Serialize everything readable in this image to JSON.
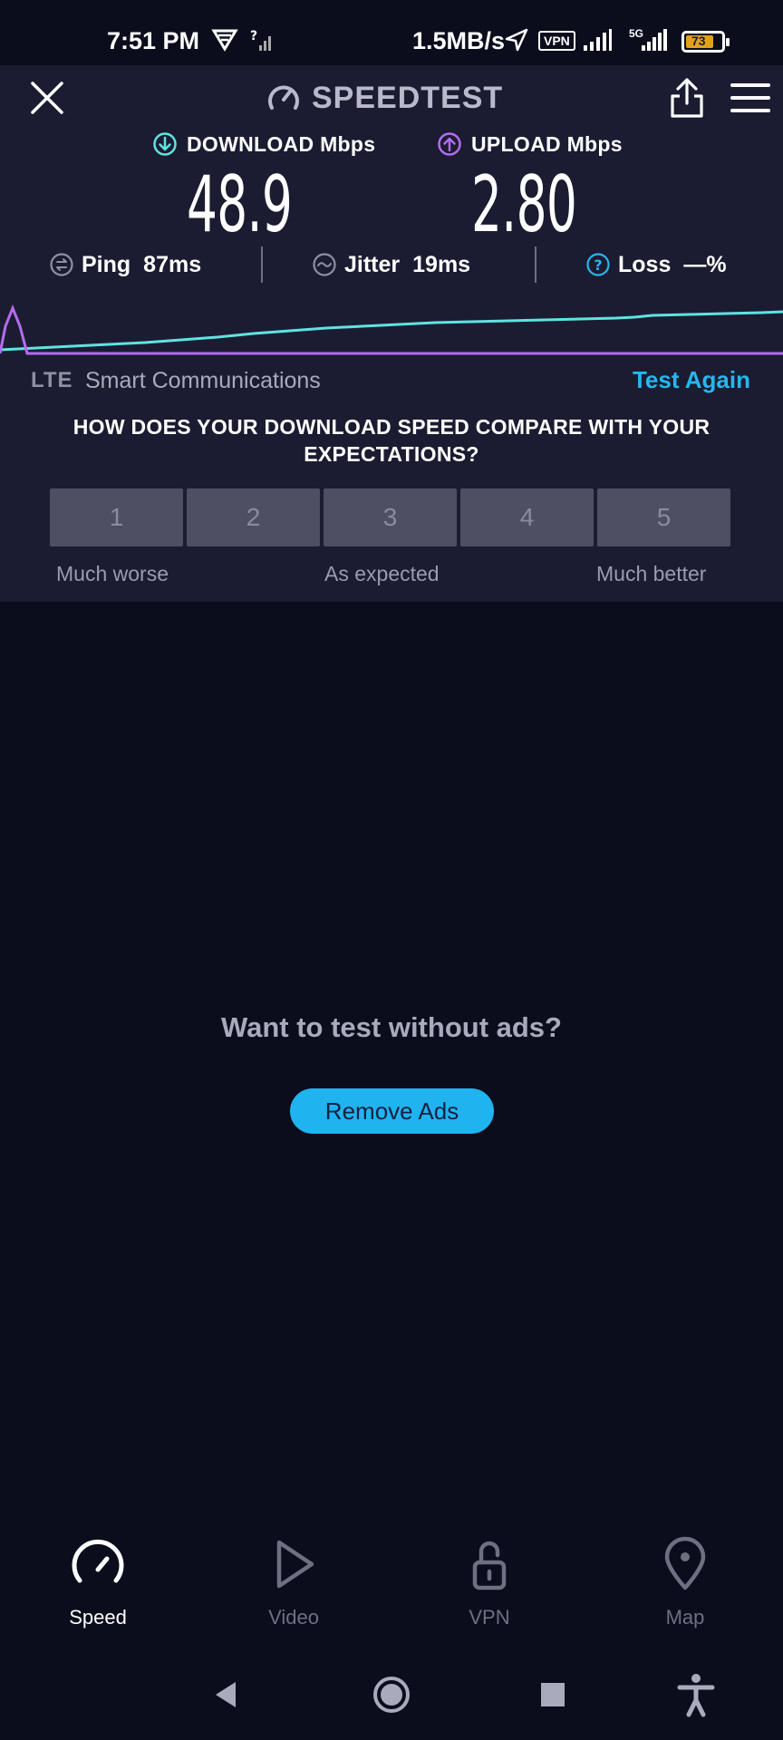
{
  "status_bar": {
    "time": "7:51 PM",
    "net_speed": "1.5MB/s",
    "vpn_badge": "VPN",
    "network_type": "5G",
    "battery": "73"
  },
  "header": {
    "app_title": "SPEEDTEST"
  },
  "results": {
    "download_label": "DOWNLOAD Mbps",
    "download_value": "48.9",
    "upload_label": "UPLOAD Mbps",
    "upload_value": "2.80",
    "ping_label": "Ping",
    "ping_value": "87ms",
    "jitter_label": "Jitter",
    "jitter_value": "19ms",
    "loss_label": "Loss",
    "loss_value": "—%"
  },
  "provider": {
    "tech": "LTE",
    "name": "Smart Communications",
    "test_again": "Test Again"
  },
  "survey": {
    "question": "HOW DOES YOUR DOWNLOAD SPEED COMPARE WITH YOUR EXPECTATIONS?",
    "options": [
      "1",
      "2",
      "3",
      "4",
      "5"
    ],
    "caption_low": "Much worse",
    "caption_mid": "As expected",
    "caption_high": "Much better"
  },
  "ad": {
    "prompt": "Want to test without ads?",
    "button": "Remove Ads"
  },
  "bottom_nav": {
    "items": [
      {
        "label": "Speed",
        "icon": "speedometer-icon",
        "active": true
      },
      {
        "label": "Video",
        "icon": "play-icon",
        "active": false
      },
      {
        "label": "VPN",
        "icon": "unlock-icon",
        "active": false
      },
      {
        "label": "Map",
        "icon": "map-pin-icon",
        "active": false
      }
    ]
  },
  "colors": {
    "download_accent": "#5fe3e0",
    "upload_accent": "#b46cf0",
    "link": "#27b6ee",
    "panel_bg": "#1b1c31",
    "page_bg": "#0b0c1c"
  }
}
